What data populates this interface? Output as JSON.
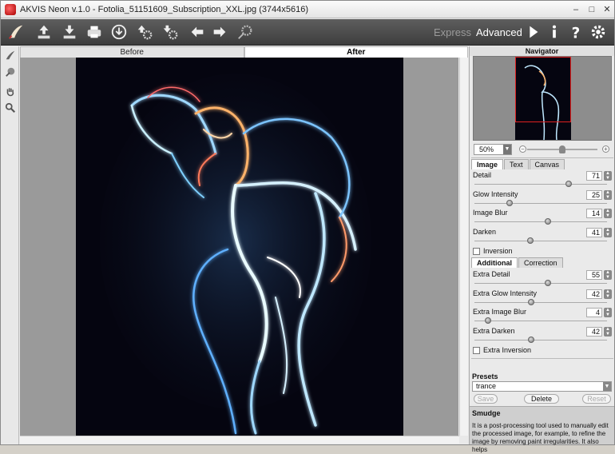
{
  "window": {
    "title": "AKVIS Neon v.1.0 - Fotolia_51151609_Subscription_XXL.jpg (3744x5616)",
    "minimize": "–",
    "maximize": "□",
    "close": "✕"
  },
  "toolbar": {
    "icons": [
      "open-icon",
      "save-icon",
      "print-icon",
      "share-icon",
      "import-presets-icon",
      "export-presets-icon",
      "undo-icon",
      "redo-icon",
      "run-icon"
    ],
    "mode_express": "Express",
    "mode_advanced": "Advanced",
    "right_icons": [
      "run-triangle-icon",
      "info-icon",
      "help-icon",
      "settings-gear-icon"
    ],
    "accent": "#3d3d3d"
  },
  "view_tabs": {
    "before": "Before",
    "after": "After"
  },
  "left_tools": [
    "neon-brush-icon",
    "smudge-icon",
    "hand-icon",
    "zoom-icon"
  ],
  "navigator": {
    "title": "Navigator",
    "zoom": "50%",
    "zoom_level": 0.5
  },
  "settings": {
    "tabs": [
      "Image",
      "Text",
      "Canvas"
    ],
    "active_tab": "Image",
    "params": [
      {
        "label": "Detail",
        "value": "71",
        "level": 0.71
      },
      {
        "label": "Glow Intensity",
        "value": "25",
        "level": 0.25
      },
      {
        "label": "Image Blur",
        "value": "14",
        "level": 0.55
      },
      {
        "label": "Darken",
        "value": "41",
        "level": 0.41
      }
    ],
    "inversion": "Inversion",
    "sub_tabs": [
      "Additional",
      "Correction"
    ],
    "extra_params": [
      {
        "label": "Extra Detail",
        "value": "55",
        "level": 0.55
      },
      {
        "label": "Extra Glow Intensity",
        "value": "42",
        "level": 0.42
      },
      {
        "label": "Extra Image Blur",
        "value": "4",
        "level": 0.08
      },
      {
        "label": "Extra Darken",
        "value": "42",
        "level": 0.42
      }
    ],
    "extra_inversion": "Extra Inversion"
  },
  "presets": {
    "title": "Presets",
    "selected": "trance",
    "save": "Save",
    "delete": "Delete",
    "reset": "Reset"
  },
  "help": {
    "title": "Smudge",
    "text": "It is a post-processing tool used to manually edit the processed image, for example, to refine the image by removing paint irregularities. It also helps"
  }
}
